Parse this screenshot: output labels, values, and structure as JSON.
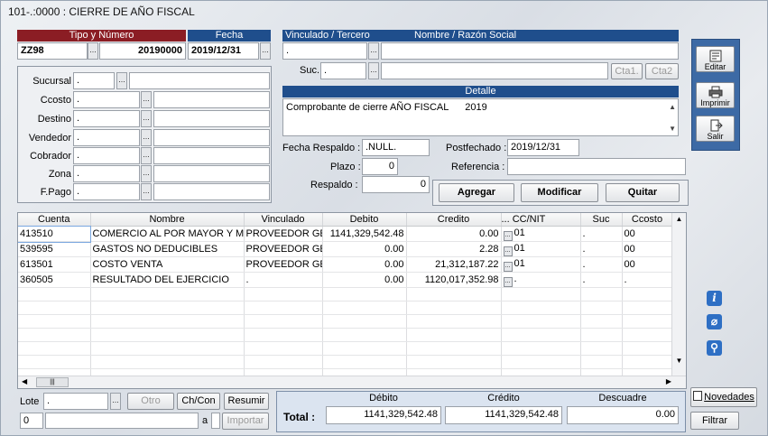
{
  "window_title": "101-.:0000 : CIERRE DE AÑO FISCAL",
  "doc": {
    "tipo_numero_header": "Tipo y Número",
    "fecha_header": "Fecha",
    "tipo": "ZZ98",
    "numero": "20190000",
    "fecha": "2019/12/31"
  },
  "tercero": {
    "vinculado_header": "Vinculado / Tercero",
    "nombre_header": "Nombre / Razón Social",
    "vinculado_value": ".",
    "suc_label": "Suc.",
    "suc_value": ".",
    "cta1": "Cta1.",
    "cta2": "Cta2"
  },
  "detalle": {
    "header": "Detalle",
    "text": "Comprobante de cierre AÑO FISCAL      2019"
  },
  "left_fields": [
    {
      "label": "Sucursal",
      "value": "."
    },
    {
      "label": "Ccosto",
      "value": "."
    },
    {
      "label": "Destino",
      "value": "."
    },
    {
      "label": "Vendedor",
      "value": "."
    },
    {
      "label": "Cobrador",
      "value": "."
    },
    {
      "label": "Zona",
      "value": "."
    },
    {
      "label": "F.Pago",
      "value": "."
    }
  ],
  "extra": {
    "fecha_respaldo_label": "Fecha Respaldo :",
    "fecha_respaldo": ".NULL.",
    "postfechado_label": "Postfechado :",
    "postfechado": "2019/12/31",
    "plazo_label": "Plazo :",
    "plazo": "0",
    "referencia_label": "Referencia :",
    "referencia": "",
    "respaldo_label": "Respaldo :",
    "respaldo": "0"
  },
  "actions": {
    "agregar": "Agregar",
    "modificar": "Modificar",
    "quitar": "Quitar"
  },
  "side_buttons": {
    "editar": "Editar",
    "imprimir": "Imprimir",
    "salir": "Salir"
  },
  "grid": {
    "columns": [
      "Cuenta",
      "Nombre",
      "Vinculado",
      "Debito",
      "Credito",
      "... CC/NIT",
      "Suc",
      "Ccosto"
    ],
    "rows": [
      [
        "413510",
        "COMERCIO AL POR MAYOR Y MENO",
        "PROVEEDOR GEN",
        "1141,329,542.48",
        "0.00",
        "01",
        ".",
        "00"
      ],
      [
        "539595",
        "GASTOS NO DEDUCIBLES",
        "PROVEEDOR GEN",
        "0.00",
        "2.28",
        "01",
        ".",
        "00"
      ],
      [
        "613501",
        "COSTO VENTA",
        "PROVEEDOR GEN",
        "0.00",
        "21,312,187.22",
        "01",
        ".",
        "00"
      ],
      [
        "360505",
        "RESULTADO DEL EJERCICIO",
        ".",
        "0.00",
        "1120,017,352.98",
        ".",
        ".",
        "."
      ]
    ]
  },
  "bottom": {
    "lote_label": "Lote",
    "lote_value": ".",
    "otro": "Otro",
    "chcon": "Ch/Con",
    "resumir": "Resumir",
    "importar": "Importar",
    "num_value": "0",
    "a_label": "a",
    "debito_header": "Débito",
    "credito_header": "Crédito",
    "descuadre_header": "Descuadre",
    "total_label": "Total :",
    "total_debito": "1141,329,542.48",
    "total_credito": "1141,329,542.48",
    "descuadre": "0.00"
  },
  "right_bottom": {
    "novedades": "Novedades",
    "filtrar": "Filtrar"
  }
}
